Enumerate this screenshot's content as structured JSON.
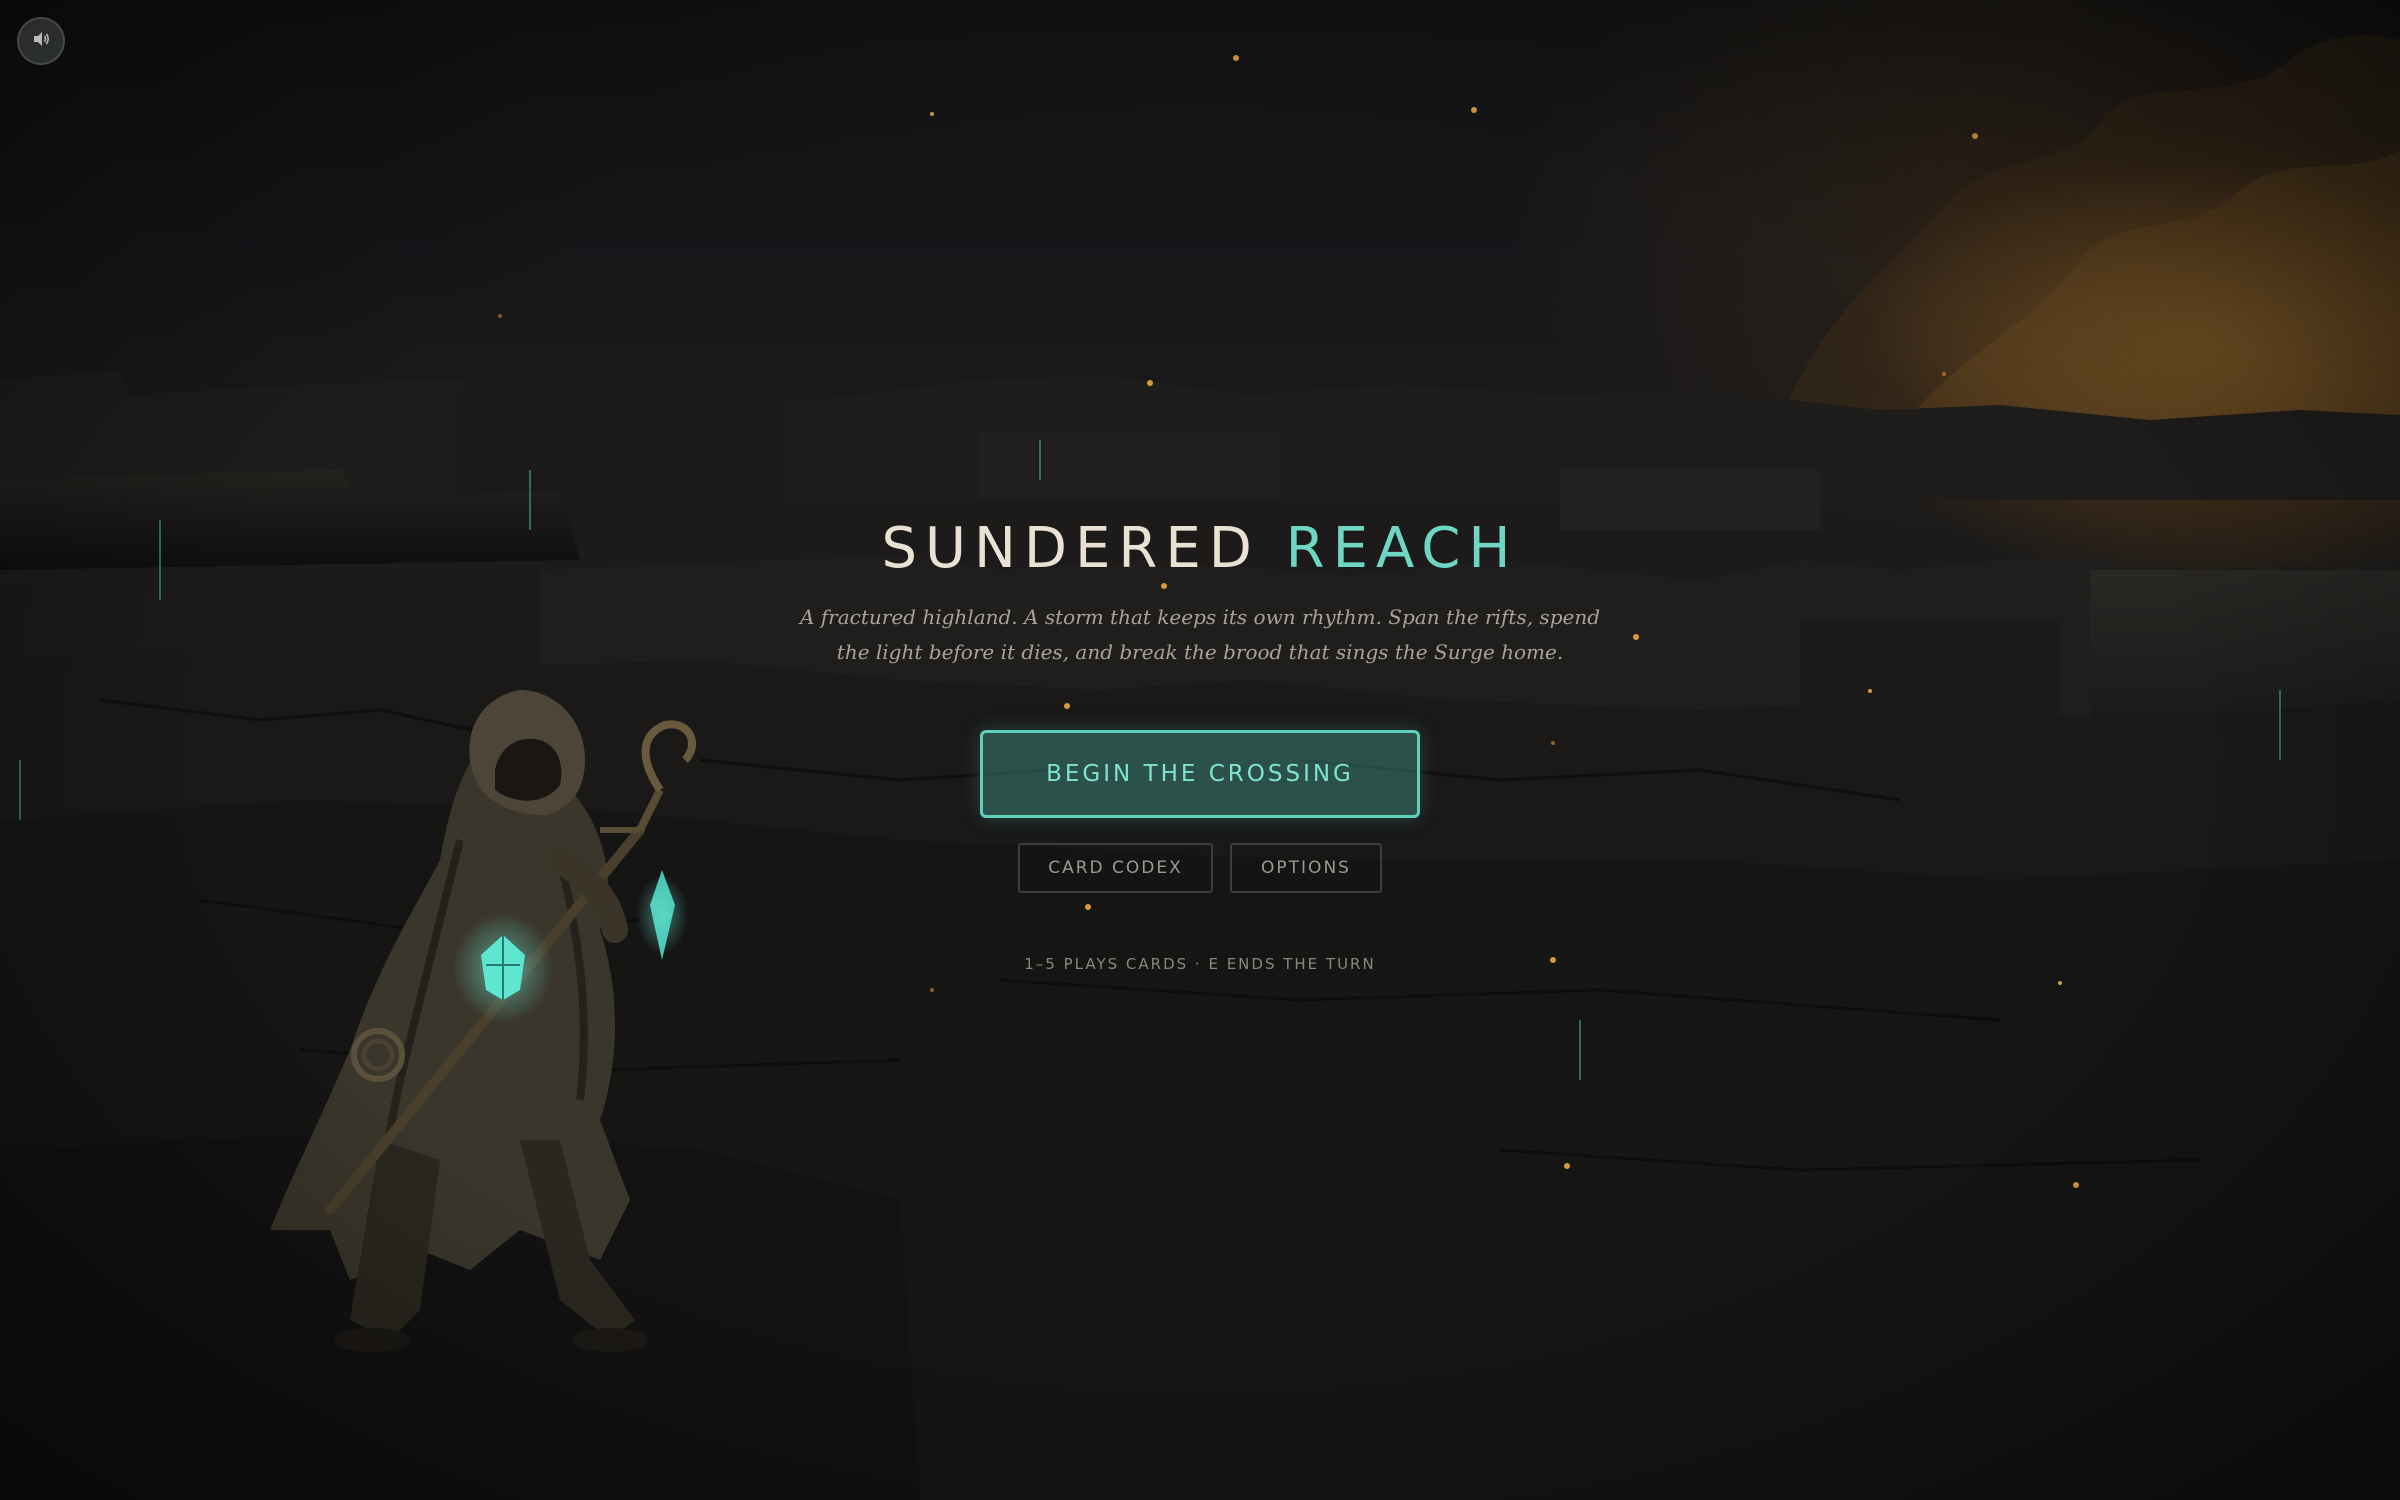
{
  "title": {
    "part1": "SUNDERED",
    "part2": "REACH"
  },
  "tagline": {
    "line1": "A fractured highland. A storm that keeps its own rhythm. Span the rifts, spend",
    "line2": "the light before it dies, and break the brood that sings the Surge home."
  },
  "menu": {
    "primary_label": "BEGIN THE CROSSING",
    "codex_label": "CARD CODEX",
    "options_label": "OPTIONS"
  },
  "hint": "1–5 PLAYS CARDS · E ENDS THE TURN",
  "sound": {
    "icon": "speaker-icon"
  },
  "colors": {
    "accent": "#6fd6c6",
    "title": "#e9e2d3",
    "ember": "#d99a3a",
    "background": "#151515"
  }
}
